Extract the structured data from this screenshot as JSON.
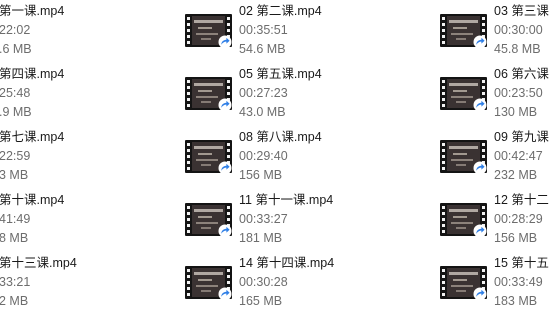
{
  "files": [
    {
      "name": "第一课.mp4",
      "duration": "22:02",
      "size": ".6 MB"
    },
    {
      "name": "02 第二课.mp4",
      "duration": "00:35:51",
      "size": "54.6 MB"
    },
    {
      "name": "03 第三课",
      "duration": "00:30:00",
      "size": "45.8 MB"
    },
    {
      "name": "第四课.mp4",
      "duration": "25:48",
      "size": ".9 MB"
    },
    {
      "name": "05 第五课.mp4",
      "duration": "00:27:23",
      "size": "43.0 MB"
    },
    {
      "name": "06 第六课",
      "duration": "00:23:50",
      "size": "130 MB"
    },
    {
      "name": "第七课.mp4",
      "duration": "22:59",
      "size": "3 MB"
    },
    {
      "name": "08 第八课.mp4",
      "duration": "00:29:40",
      "size": "156 MB"
    },
    {
      "name": "09 第九课",
      "duration": "00:42:47",
      "size": "232 MB"
    },
    {
      "name": "第十课.mp4",
      "duration": "41:49",
      "size": "8 MB"
    },
    {
      "name": "11 第十一课.mp4",
      "duration": "00:33:27",
      "size": "181 MB"
    },
    {
      "name": "12 第十二",
      "duration": "00:28:29",
      "size": "156 MB"
    },
    {
      "name": "第十三课.mp4",
      "duration": "33:21",
      "size": "2 MB"
    },
    {
      "name": "14 第十四课.mp4",
      "duration": "00:30:28",
      "size": "165 MB"
    },
    {
      "name": "15 第十五",
      "duration": "00:33:49",
      "size": "183 MB"
    }
  ],
  "icons": {
    "video_thumbnail": "video-file-icon",
    "shortcut_badge": "shortcut-arrow-icon",
    "badge_color": "#2f7fe6"
  }
}
